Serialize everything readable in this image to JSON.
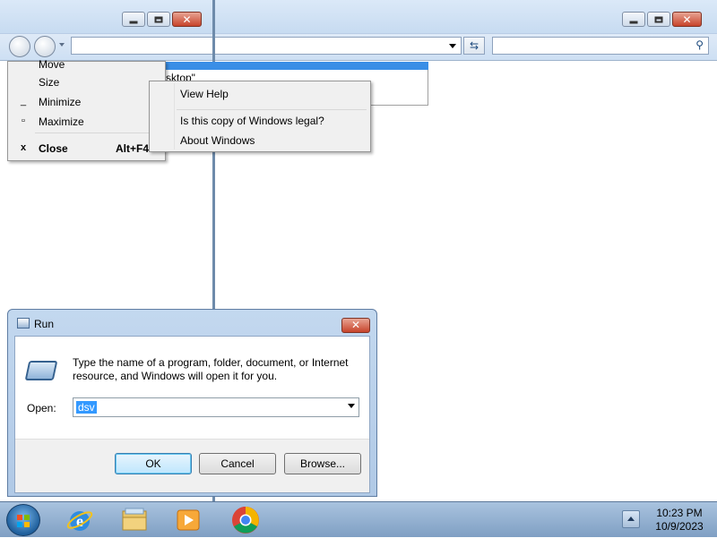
{
  "system_menu": {
    "items": [
      {
        "label": "Move",
        "glyph": ""
      },
      {
        "label": "Size",
        "glyph": ""
      },
      {
        "label": "Minimize",
        "glyph": "_"
      },
      {
        "label": "Maximize",
        "glyph": "▫"
      },
      {
        "label": "Close",
        "glyph": "x",
        "accelerator": "Alt+F4"
      }
    ]
  },
  "help_menu": {
    "items": [
      {
        "label": "View Help"
      },
      {
        "label": "Is this copy of Windows legal?"
      },
      {
        "label": "About Windows"
      }
    ]
  },
  "background_text": "sktop\"",
  "run_dialog": {
    "title": "Run",
    "description": "Type the name of a program, folder, document, or Internet resource, and Windows will open it for you.",
    "open_label": "Open:",
    "open_value": "dsv",
    "ok_label": "OK",
    "cancel_label": "Cancel",
    "browse_label": "Browse..."
  },
  "taskbar": {
    "pinned": [
      "internet-explorer-icon",
      "windows-explorer-icon",
      "media-player-icon",
      "chrome-icon"
    ],
    "time": "10:23 PM",
    "date": "10/9/2023"
  }
}
